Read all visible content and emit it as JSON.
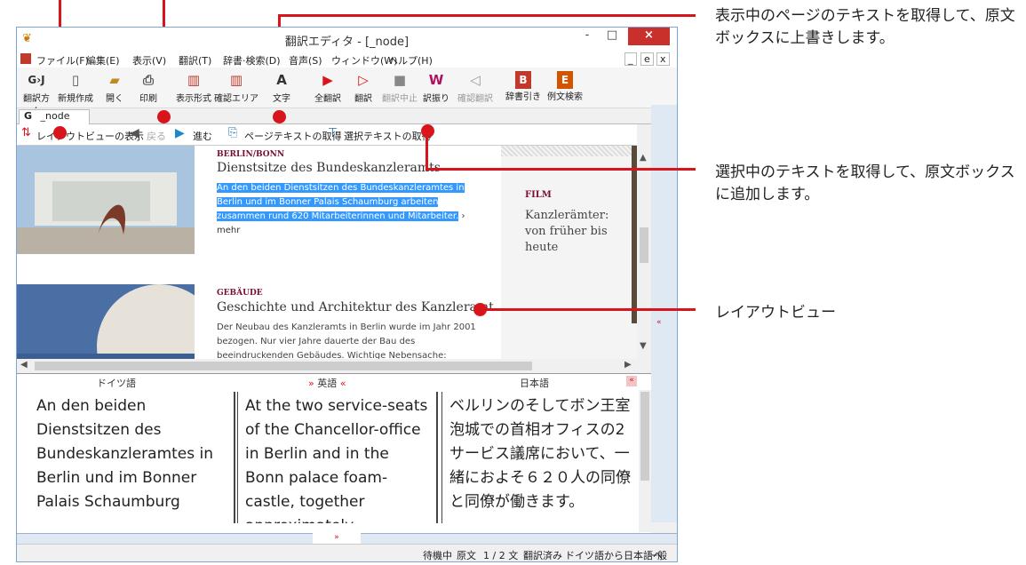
{
  "window": {
    "title": "翻訳エディタ - [_node]",
    "controls": [
      "-",
      "□",
      "×"
    ],
    "mdi_controls": [
      "_",
      "e",
      "x"
    ]
  },
  "menu": [
    "ファイル(F)",
    "編集(E)",
    "表示(V)",
    "翻訳(T)",
    "辞書·検索(D)",
    "音声(S)",
    "ウィンドウ(W)",
    "ヘルプ(H)"
  ],
  "toolbar": [
    {
      "label": "翻訳方向",
      "icon": "G›J"
    },
    {
      "label": "新規作成",
      "icon": "▯"
    },
    {
      "label": "開く",
      "icon": "▰"
    },
    {
      "label": "印刷",
      "icon": "⎙"
    },
    {
      "label": "表示形式",
      "icon": "▥"
    },
    {
      "label": "確認エリア",
      "icon": "▥"
    },
    {
      "label": "文字",
      "icon": "A"
    },
    {
      "label": "全翻訳",
      "icon": "▶"
    },
    {
      "label": "翻訳",
      "icon": "▷"
    },
    {
      "label": "翻訳中止",
      "icon": "■"
    },
    {
      "label": "訳振り",
      "icon": "W"
    },
    {
      "label": "確認翻訳",
      "icon": "◁"
    },
    {
      "label": "辞書引き",
      "icon": "B"
    },
    {
      "label": "例文検索",
      "icon": "E"
    }
  ],
  "tab": {
    "icon": "G",
    "label": "_node"
  },
  "nav": {
    "layout_view": "レイアウトビューの表示",
    "back": "戻る",
    "forward": "進む",
    "get_page_text": "ページテキストの取得",
    "get_selected_text": "選択テキストの取得"
  },
  "article1": {
    "kicker": "BERLIN/BONN",
    "title": "Dienstsitze des Bundeskanzleramts",
    "body": "An den beiden Dienstsitzen des Bundeskanzleramtes in Berlin und im Bonner Palais Schaumburg arbeiten zusammen rund 620 Mitarbeiterinnen und Mitarbeiter.",
    "more": "mehr"
  },
  "article2": {
    "kicker": "GEBÄUDE",
    "title": "Geschichte und Architektur des Kanzleramt",
    "body": "Der Neubau des Kanzleramts in Berlin wurde im Jahr 2001 bezogen. Nur vier Jahre dauerte der Bau des beeindruckenden Gebäudes. Wichtige Nebensache:"
  },
  "film": {
    "kicker": "FILM",
    "title": "Kanzlerämter: von früher bis heute"
  },
  "panes": {
    "german": {
      "header": "ドイツ語",
      "text": "An den beiden Dienstsitzen des Bundeskanzleramtes in Berlin und im Bonner Palais Schaumburg"
    },
    "english": {
      "header": "英語",
      "text": "At the two service-seats of the Chancellor-office in Berlin and in the Bonn palace foam-castle, together approximately"
    },
    "japanese": {
      "header": "日本語",
      "text": "ベルリンのそしてボン王室泡城での首相オフィスの2サービス議席において、一緒におよそ６２０人の同僚と同僚が働きます。"
    }
  },
  "status": [
    "待機中",
    "原文",
    "1 / 2 文",
    "翻訳済み",
    "ドイツ語から日本語へ",
    "一般"
  ],
  "callouts": {
    "page_text": "表示中のページのテキストを取得して、原文ボックスに上書きします。",
    "selected_text": "選択中のテキストを取得して、原文ボックスに追加します。",
    "layout_view": "レイアウトビュー"
  },
  "colors": {
    "accent_red": "#d8141c",
    "selection": "#3399ff",
    "kicker": "#7a1030"
  }
}
